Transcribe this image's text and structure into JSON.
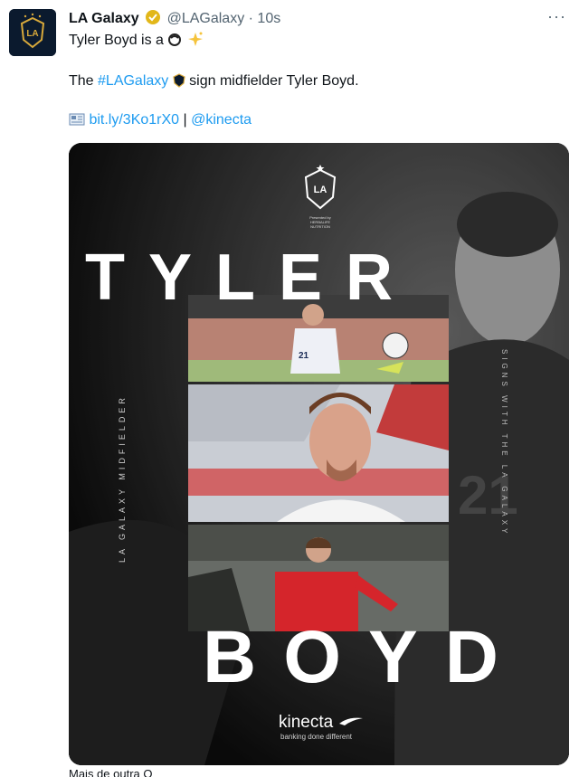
{
  "tweet": {
    "author_name": "LA Galaxy",
    "handle": "@LAGalaxy",
    "separator": "·",
    "time": "10s",
    "more_label": "···",
    "line1_text": "Tyler Boyd is a",
    "line2_prefix": "The ",
    "hashtag": "#LAGalaxy",
    "line2_suffix": " sign midfielder Tyler Boyd.",
    "url_text": "bit.ly/3Ko1rX0",
    "url_sep": " | ",
    "mention": "@kinecta"
  },
  "media": {
    "word_top": "TYLER",
    "word_bottom": "BOYD",
    "vertical_left": "LA GALAXY MIDFIELDER",
    "vertical_right": "SIGNS WITH THE LA GALAXY",
    "crest_text": "LA",
    "crest_subtext": "Presented by HERBALIFE NUTRITION",
    "sponsor_name": "kinecta",
    "sponsor_tagline": "banking done different",
    "jersey_number_big": "21",
    "jersey_number_small": "21"
  },
  "footer": {
    "cut_text": "Mais de outra O"
  },
  "icons": {
    "avatar": "la-galaxy-logo-icon",
    "verified": "verified-gold-badge-icon",
    "emoji_goat": "goat-emoji-icon",
    "emoji_sparkle": "sparkle-emoji-icon",
    "emoji_crest": "la-galaxy-crest-emoji-icon",
    "link": "newspaper-emoji-icon",
    "more": "more-dots-icon"
  },
  "colors": {
    "link": "#1d9bf0",
    "gold": "#e2b719",
    "muted": "#536471"
  }
}
